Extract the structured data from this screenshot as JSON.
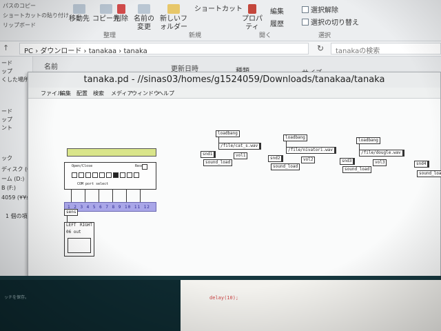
{
  "ribbon": {
    "left_items": [
      "パスのコピー",
      "ショートカットの貼り付け",
      "リップボード"
    ],
    "buttons": [
      "移動先",
      "コピー先",
      "削除",
      "名前の変更",
      "新しいフォルダー"
    ],
    "shortcut": "ショートカット",
    "properties": "プロパティ",
    "edit": "編集",
    "history": "履歴",
    "deselect": "選択解除",
    "invert": "選択の切り替え",
    "groups": [
      "整理",
      "新規",
      "開く",
      "選択"
    ]
  },
  "address": {
    "path": "PC › ダウンロード › tanakaa › tanaka",
    "search_placeholder": "tanakaの検索"
  },
  "columns": [
    "名前",
    "更新日時",
    "種類",
    "サイズ"
  ],
  "nav_pane": {
    "items": [
      "ード",
      "ップ",
      "くした場所",
      "ード",
      "ップ",
      "ント",
      "ック",
      "ディスク (C",
      "ーム (D:)",
      "B (F:)",
      "4059 (¥¥si",
      "1 個の項目"
    ]
  },
  "pd": {
    "title": "tanaka.pd  - //sinas03/homes/g1524059/Downloads/tanakaa/tanaka",
    "menu": [
      "ファイル",
      "編集",
      "配置",
      "検索",
      "メディア",
      "ウィンドウ",
      "ヘルプ"
    ],
    "serial": {
      "open_close": "Open/Close",
      "reset": "Reset",
      "com_select": "COM port select",
      "ports": "1 2 3 4 5 6 7 8 9 10 11 12"
    },
    "sub": {
      "name": "sens",
      "left": "LEFT",
      "right": "RIGHT",
      "status": "06 out"
    },
    "groups": [
      {
        "loadbang": "loadbang",
        "file": "/file/cat_s.wav",
        "snd": "snd1",
        "vol": "vol1",
        "load": "sound_load"
      },
      {
        "loadbang": "loadbang",
        "file": "/file/nivatori.wav",
        "snd": "snd2",
        "vol": "vol2",
        "load": "sound_load"
      },
      {
        "loadbang": "loadbang",
        "file": "/file/dougle.wav",
        "snd": "snd3",
        "vol": "vol3",
        "load": "sound_load"
      },
      {
        "snd": "snd4",
        "load": "sound_load"
      }
    ]
  },
  "editor": {
    "left_text": "ッチを保存。",
    "right_text": "delay(10);"
  }
}
